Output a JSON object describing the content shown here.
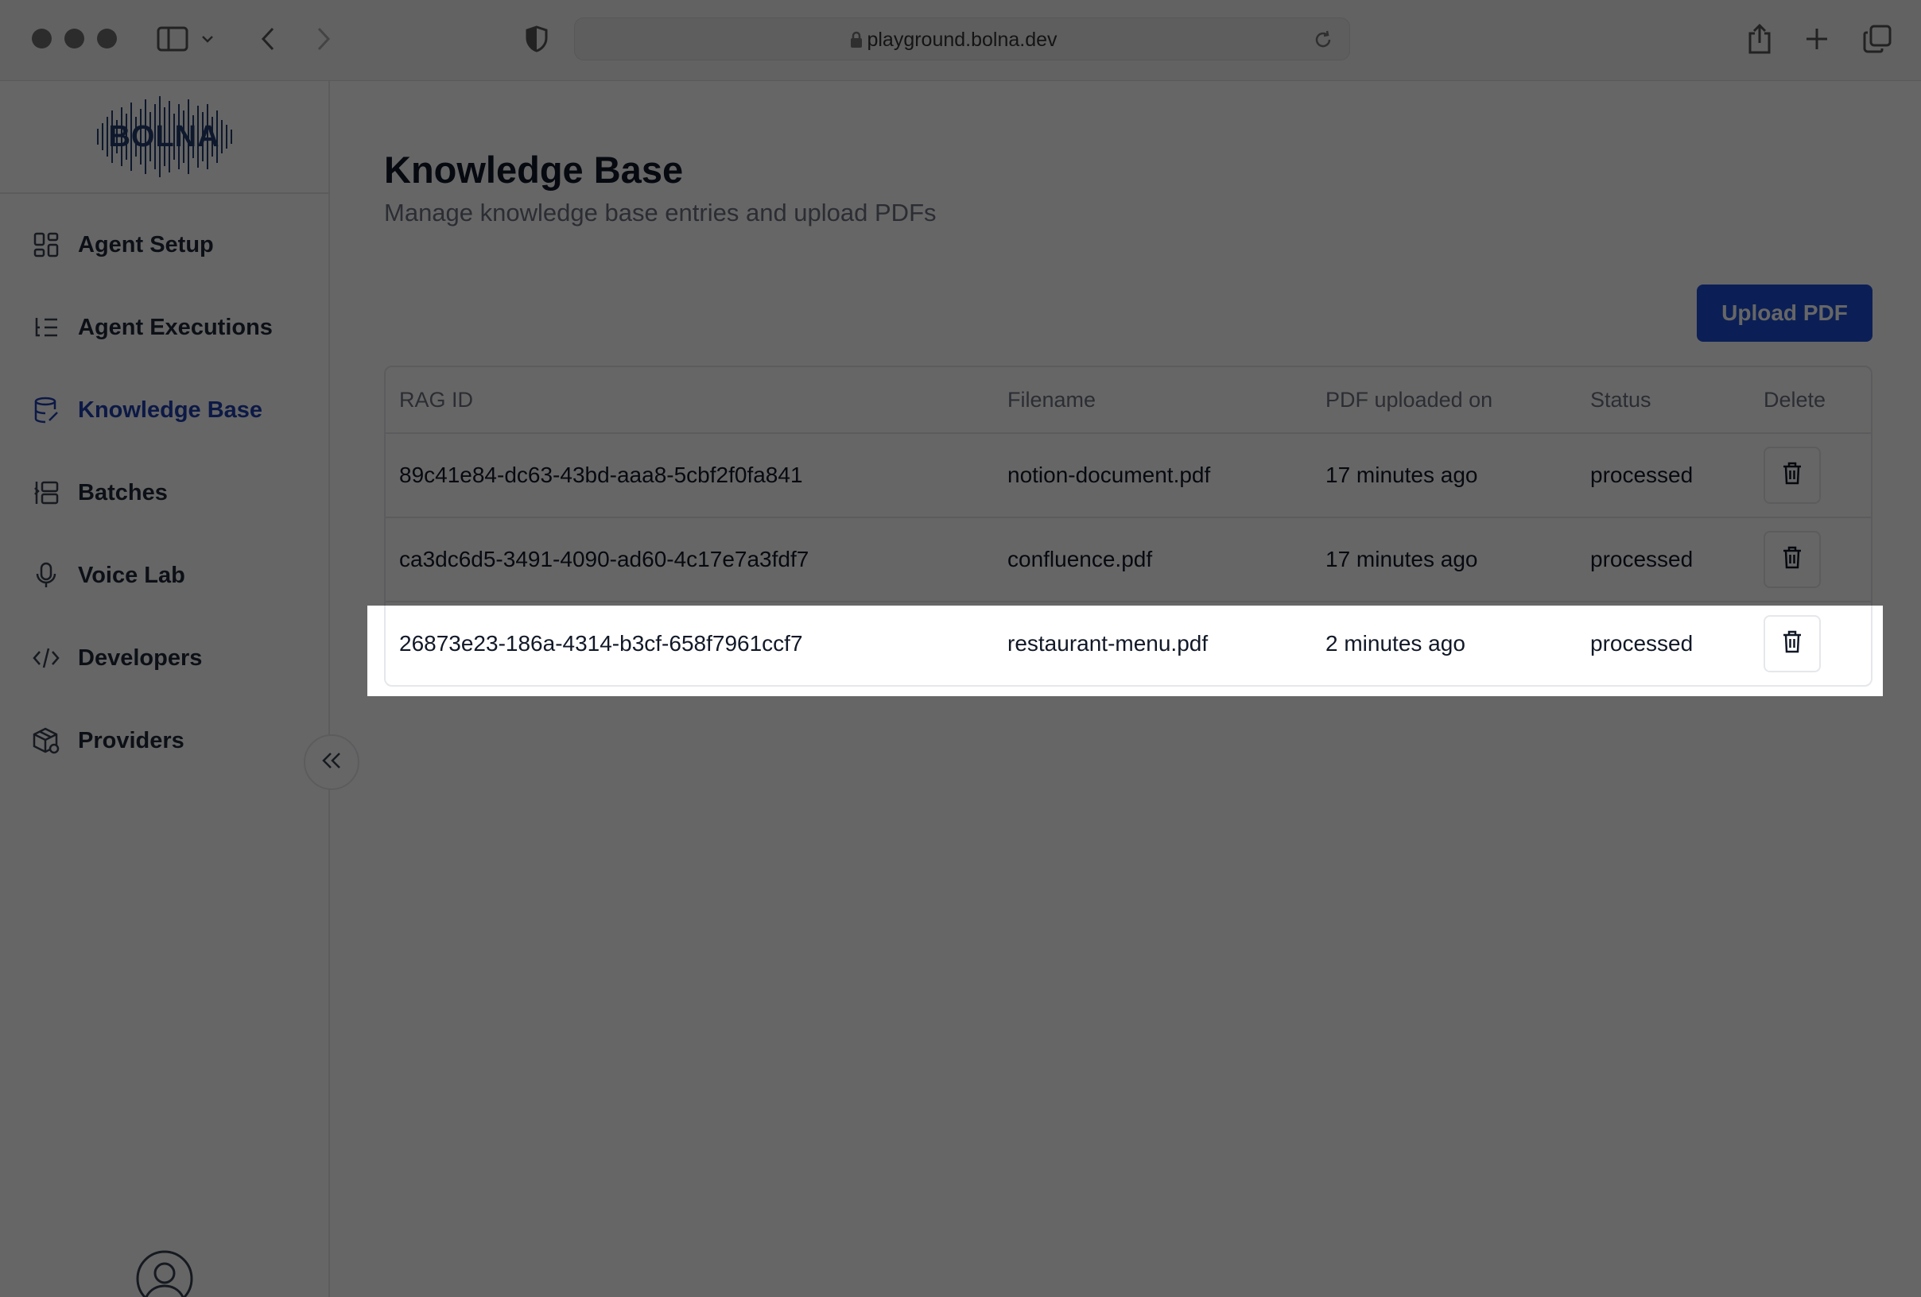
{
  "browser": {
    "url": "playground.bolna.dev"
  },
  "app": {
    "logo_text": "BOLNA"
  },
  "sidebar": {
    "items": [
      {
        "label": "Agent Setup",
        "icon": "dashboard-grid-icon",
        "active": false
      },
      {
        "label": "Agent Executions",
        "icon": "list-tree-icon",
        "active": false
      },
      {
        "label": "Knowledge Base",
        "icon": "database-icon",
        "active": true
      },
      {
        "label": "Batches",
        "icon": "batches-icon",
        "active": false
      },
      {
        "label": "Voice Lab",
        "icon": "microphone-icon",
        "active": false
      },
      {
        "label": "Developers",
        "icon": "code-icon",
        "active": false
      },
      {
        "label": "Providers",
        "icon": "package-icon",
        "active": false
      }
    ]
  },
  "page": {
    "title": "Knowledge Base",
    "subtitle": "Manage knowledge base entries and upload PDFs",
    "upload_label": "Upload PDF"
  },
  "table": {
    "headers": [
      "RAG ID",
      "Filename",
      "PDF uploaded on",
      "Status",
      "Delete"
    ],
    "rows": [
      [
        "89c41e84-dc63-43bd-aaa8-5cbf2f0fa841",
        "notion-document.pdf",
        "17 minutes ago",
        "processed"
      ],
      [
        "ca3dc6d5-3491-4090-ad60-4c17e7a3fdf7",
        "confluence.pdf",
        "17 minutes ago",
        "processed"
      ],
      [
        "26873e23-186a-4314-b3cf-658f7961ccf7",
        "restaurant-menu.pdf",
        "2 minutes ago",
        "processed"
      ]
    ]
  },
  "colors": {
    "accent": "#1d4ed8",
    "active_nav": "#1e40af",
    "overlay": "rgba(0,0,0,0.6)"
  }
}
